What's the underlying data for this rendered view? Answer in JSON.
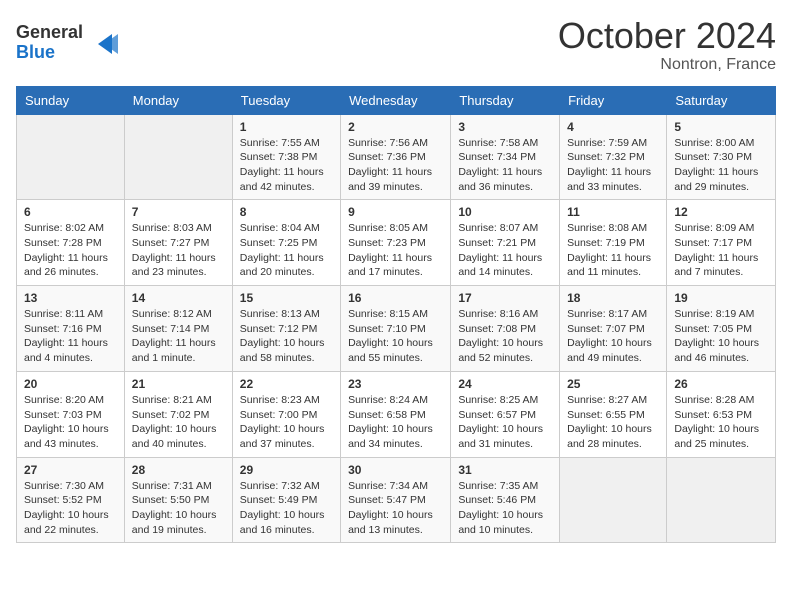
{
  "header": {
    "logo_line1": "General",
    "logo_line2": "Blue",
    "month": "October 2024",
    "location": "Nontron, France"
  },
  "weekdays": [
    "Sunday",
    "Monday",
    "Tuesday",
    "Wednesday",
    "Thursday",
    "Friday",
    "Saturday"
  ],
  "weeks": [
    [
      {
        "day": "",
        "sunrise": "",
        "sunset": "",
        "daylight": ""
      },
      {
        "day": "",
        "sunrise": "",
        "sunset": "",
        "daylight": ""
      },
      {
        "day": "1",
        "sunrise": "Sunrise: 7:55 AM",
        "sunset": "Sunset: 7:38 PM",
        "daylight": "Daylight: 11 hours and 42 minutes."
      },
      {
        "day": "2",
        "sunrise": "Sunrise: 7:56 AM",
        "sunset": "Sunset: 7:36 PM",
        "daylight": "Daylight: 11 hours and 39 minutes."
      },
      {
        "day": "3",
        "sunrise": "Sunrise: 7:58 AM",
        "sunset": "Sunset: 7:34 PM",
        "daylight": "Daylight: 11 hours and 36 minutes."
      },
      {
        "day": "4",
        "sunrise": "Sunrise: 7:59 AM",
        "sunset": "Sunset: 7:32 PM",
        "daylight": "Daylight: 11 hours and 33 minutes."
      },
      {
        "day": "5",
        "sunrise": "Sunrise: 8:00 AM",
        "sunset": "Sunset: 7:30 PM",
        "daylight": "Daylight: 11 hours and 29 minutes."
      }
    ],
    [
      {
        "day": "6",
        "sunrise": "Sunrise: 8:02 AM",
        "sunset": "Sunset: 7:28 PM",
        "daylight": "Daylight: 11 hours and 26 minutes."
      },
      {
        "day": "7",
        "sunrise": "Sunrise: 8:03 AM",
        "sunset": "Sunset: 7:27 PM",
        "daylight": "Daylight: 11 hours and 23 minutes."
      },
      {
        "day": "8",
        "sunrise": "Sunrise: 8:04 AM",
        "sunset": "Sunset: 7:25 PM",
        "daylight": "Daylight: 11 hours and 20 minutes."
      },
      {
        "day": "9",
        "sunrise": "Sunrise: 8:05 AM",
        "sunset": "Sunset: 7:23 PM",
        "daylight": "Daylight: 11 hours and 17 minutes."
      },
      {
        "day": "10",
        "sunrise": "Sunrise: 8:07 AM",
        "sunset": "Sunset: 7:21 PM",
        "daylight": "Daylight: 11 hours and 14 minutes."
      },
      {
        "day": "11",
        "sunrise": "Sunrise: 8:08 AM",
        "sunset": "Sunset: 7:19 PM",
        "daylight": "Daylight: 11 hours and 11 minutes."
      },
      {
        "day": "12",
        "sunrise": "Sunrise: 8:09 AM",
        "sunset": "Sunset: 7:17 PM",
        "daylight": "Daylight: 11 hours and 7 minutes."
      }
    ],
    [
      {
        "day": "13",
        "sunrise": "Sunrise: 8:11 AM",
        "sunset": "Sunset: 7:16 PM",
        "daylight": "Daylight: 11 hours and 4 minutes."
      },
      {
        "day": "14",
        "sunrise": "Sunrise: 8:12 AM",
        "sunset": "Sunset: 7:14 PM",
        "daylight": "Daylight: 11 hours and 1 minute."
      },
      {
        "day": "15",
        "sunrise": "Sunrise: 8:13 AM",
        "sunset": "Sunset: 7:12 PM",
        "daylight": "Daylight: 10 hours and 58 minutes."
      },
      {
        "day": "16",
        "sunrise": "Sunrise: 8:15 AM",
        "sunset": "Sunset: 7:10 PM",
        "daylight": "Daylight: 10 hours and 55 minutes."
      },
      {
        "day": "17",
        "sunrise": "Sunrise: 8:16 AM",
        "sunset": "Sunset: 7:08 PM",
        "daylight": "Daylight: 10 hours and 52 minutes."
      },
      {
        "day": "18",
        "sunrise": "Sunrise: 8:17 AM",
        "sunset": "Sunset: 7:07 PM",
        "daylight": "Daylight: 10 hours and 49 minutes."
      },
      {
        "day": "19",
        "sunrise": "Sunrise: 8:19 AM",
        "sunset": "Sunset: 7:05 PM",
        "daylight": "Daylight: 10 hours and 46 minutes."
      }
    ],
    [
      {
        "day": "20",
        "sunrise": "Sunrise: 8:20 AM",
        "sunset": "Sunset: 7:03 PM",
        "daylight": "Daylight: 10 hours and 43 minutes."
      },
      {
        "day": "21",
        "sunrise": "Sunrise: 8:21 AM",
        "sunset": "Sunset: 7:02 PM",
        "daylight": "Daylight: 10 hours and 40 minutes."
      },
      {
        "day": "22",
        "sunrise": "Sunrise: 8:23 AM",
        "sunset": "Sunset: 7:00 PM",
        "daylight": "Daylight: 10 hours and 37 minutes."
      },
      {
        "day": "23",
        "sunrise": "Sunrise: 8:24 AM",
        "sunset": "Sunset: 6:58 PM",
        "daylight": "Daylight: 10 hours and 34 minutes."
      },
      {
        "day": "24",
        "sunrise": "Sunrise: 8:25 AM",
        "sunset": "Sunset: 6:57 PM",
        "daylight": "Daylight: 10 hours and 31 minutes."
      },
      {
        "day": "25",
        "sunrise": "Sunrise: 8:27 AM",
        "sunset": "Sunset: 6:55 PM",
        "daylight": "Daylight: 10 hours and 28 minutes."
      },
      {
        "day": "26",
        "sunrise": "Sunrise: 8:28 AM",
        "sunset": "Sunset: 6:53 PM",
        "daylight": "Daylight: 10 hours and 25 minutes."
      }
    ],
    [
      {
        "day": "27",
        "sunrise": "Sunrise: 7:30 AM",
        "sunset": "Sunset: 5:52 PM",
        "daylight": "Daylight: 10 hours and 22 minutes."
      },
      {
        "day": "28",
        "sunrise": "Sunrise: 7:31 AM",
        "sunset": "Sunset: 5:50 PM",
        "daylight": "Daylight: 10 hours and 19 minutes."
      },
      {
        "day": "29",
        "sunrise": "Sunrise: 7:32 AM",
        "sunset": "Sunset: 5:49 PM",
        "daylight": "Daylight: 10 hours and 16 minutes."
      },
      {
        "day": "30",
        "sunrise": "Sunrise: 7:34 AM",
        "sunset": "Sunset: 5:47 PM",
        "daylight": "Daylight: 10 hours and 13 minutes."
      },
      {
        "day": "31",
        "sunrise": "Sunrise: 7:35 AM",
        "sunset": "Sunset: 5:46 PM",
        "daylight": "Daylight: 10 hours and 10 minutes."
      },
      {
        "day": "",
        "sunrise": "",
        "sunset": "",
        "daylight": ""
      },
      {
        "day": "",
        "sunrise": "",
        "sunset": "",
        "daylight": ""
      }
    ]
  ]
}
